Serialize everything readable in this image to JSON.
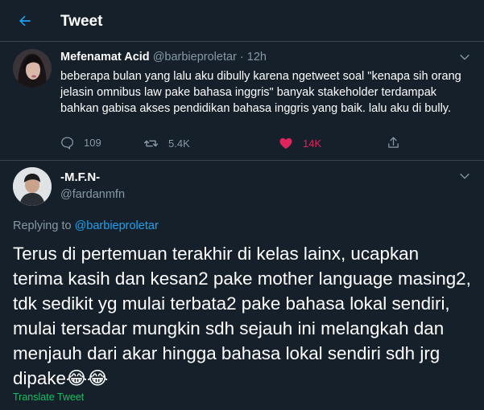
{
  "header": {
    "title": "Tweet",
    "back_icon": "arrow-left-icon",
    "accent": "#1da1f2"
  },
  "parent_tweet": {
    "name": "Mefenamat Acid",
    "handle": "@barbieproletar",
    "separator": "·",
    "time": "12h",
    "text": "beberapa bulan yang lalu aku dibully karena ngetweet soal \"kenapa sih orang jelasin omnibus law pake bahasa inggris\" banyak stakeholder terdampak bahkan gabisa akses pendidikan bahasa inggris yang baik. lalu aku di bully.",
    "replies": "109",
    "retweets": "5.4K",
    "likes": "14K",
    "like_color": "#e0245e"
  },
  "reply_tweet": {
    "name": "-M.F.N-",
    "handle": "@fardanmfn",
    "replying_prefix": "Replying to",
    "replying_handle": "@barbieproletar",
    "text": "Terus di pertemuan terakhir di kelas lainx, ucapkan terima kasih dan kesan2 pake mother language masing2, tdk sedikit yg mulai terbata2 pake bahasa lokal sendiri, mulai tersadar mungkin sdh sejauh ini melangkah dan menjauh dari akar hingga bahasa lokal sendiri sdh jrg dipake😂😂",
    "translate_label": "Translate Tweet",
    "translate_color": "#17bf63"
  },
  "theme": {
    "background": "#15202b",
    "border": "#38444d",
    "secondary_text": "#8899a6"
  }
}
